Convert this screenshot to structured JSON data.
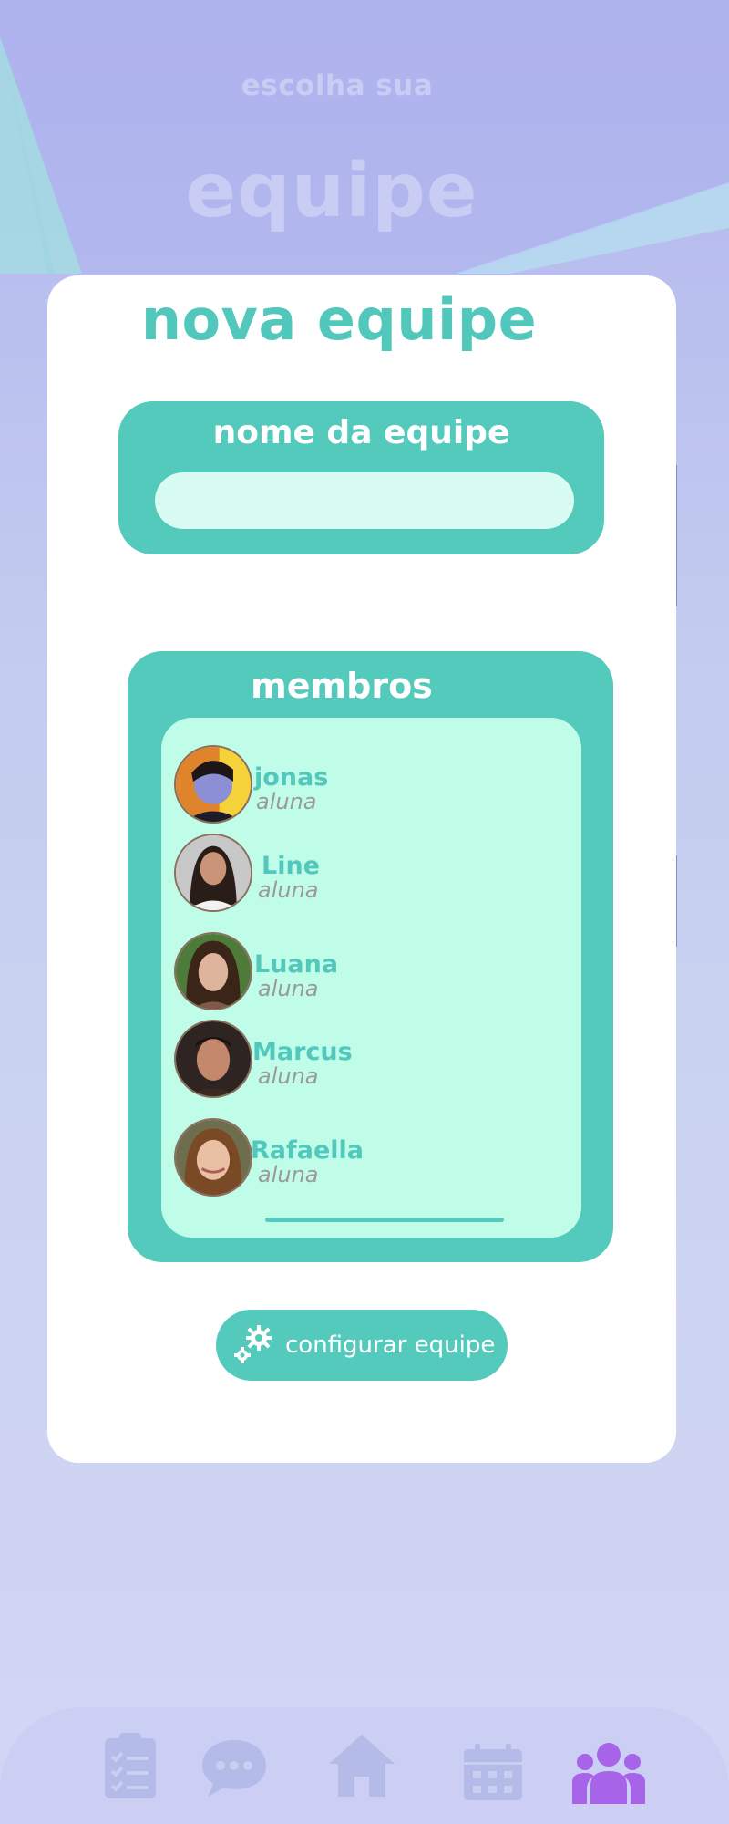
{
  "header": {
    "subtitle": "escolha sua",
    "title": "equipe"
  },
  "card": {
    "title": "nova equipe",
    "team_name": {
      "label": "nome da equipe",
      "value": "",
      "placeholder": ""
    },
    "members": {
      "label": "membros",
      "items": [
        {
          "name": "jonas",
          "role": "aluna"
        },
        {
          "name": "Line",
          "role": "aluna"
        },
        {
          "name": "Luana",
          "role": "aluna"
        },
        {
          "name": "Marcus",
          "role": "aluna"
        },
        {
          "name": "Rafaella",
          "role": "aluna"
        }
      ]
    },
    "config_button": {
      "label": "configurar equipe",
      "icon": "gears-icon"
    }
  },
  "bottom_nav": {
    "items": [
      {
        "icon": "clipboard-list-icon",
        "active": false
      },
      {
        "icon": "chat-bubble-icon",
        "active": false
      },
      {
        "icon": "home-icon",
        "active": false
      },
      {
        "icon": "calendar-icon",
        "active": false
      },
      {
        "icon": "users-group-icon",
        "active": true
      }
    ]
  },
  "colors": {
    "accent_teal": "#54cabd",
    "input_fill": "#d8fbf2",
    "list_fill": "#c0fde9",
    "nav_active": "#a764e8",
    "nav_inactive": "#b4bbe8",
    "header_text": "#c9cdf3"
  }
}
